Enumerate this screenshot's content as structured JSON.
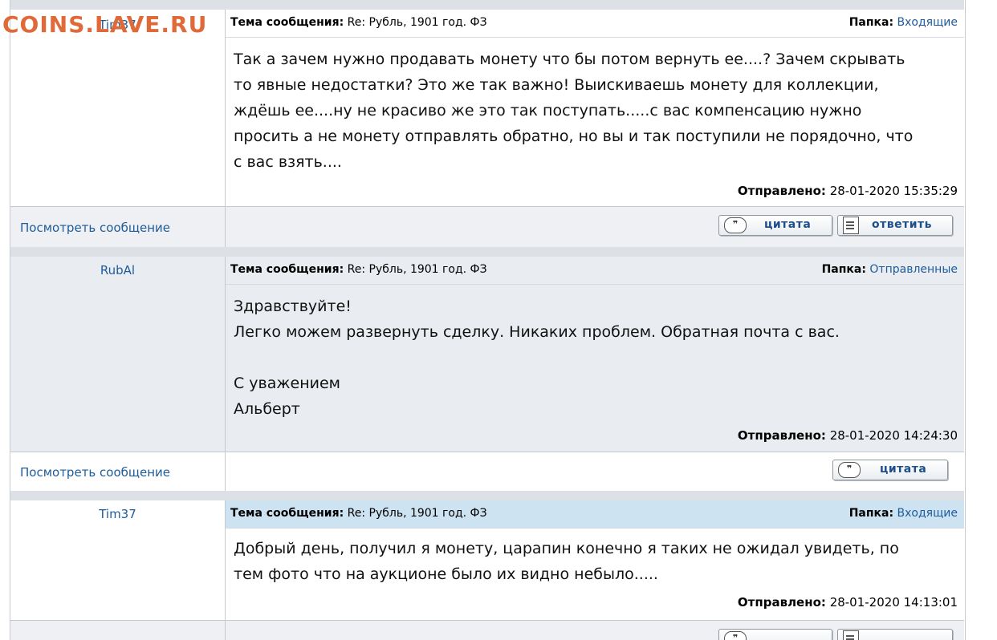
{
  "watermark": "COINS.LAVE.RU",
  "view_link": "Посмотреть сообщение",
  "subject_label": "Тема сообщения:",
  "folder_label": "Папка:",
  "sent_label": "Отправлено:",
  "quote_label": "цитата",
  "reply_label": "ответить",
  "messages": [
    {
      "author": "Tim37",
      "subject": "Re: Рубль, 1901 год. ФЗ",
      "folder": "Входящие",
      "lines": [
        "Так а зачем нужно продавать монету что бы потом вернуть ее....? Зачем скрывать",
        "то явные недостатки? Это же так важно! Выискиваешь монету для коллекции,",
        "ждёшь ее....ну не красиво же это так поступать.....с вас компенсацию нужно",
        "просить а не монету отправлять обратно, но вы и так поступили не порядочно, что",
        "с вас взять...."
      ],
      "sent": "28-01-2020 15:35:29"
    },
    {
      "author": "RubAl",
      "subject": "Re: Рубль, 1901 год. ФЗ",
      "folder": "Отправленные",
      "lines": [
        "Здравствуйте!",
        "Легко можем развернуть сделку. Никаких проблем. Обратная почта с вас.",
        "",
        "С уважением",
        "Альберт"
      ],
      "sent": "28-01-2020 14:24:30"
    },
    {
      "author": "Tim37",
      "subject": "Re: Рубль, 1901 год. ФЗ",
      "folder": "Входящие",
      "lines": [
        "Добрый день, получил я монету, царапин конечно я таких не ожидал увидеть, по",
        "тем фото что на аукционе было их видно небыло....."
      ],
      "sent": "28-01-2020 14:13:01"
    }
  ],
  "colors": {
    "link": "#1e5b9b",
    "gray_bg": "#e9ecf0",
    "selected_header": "#cde3f2",
    "watermark": "#e0693a"
  }
}
